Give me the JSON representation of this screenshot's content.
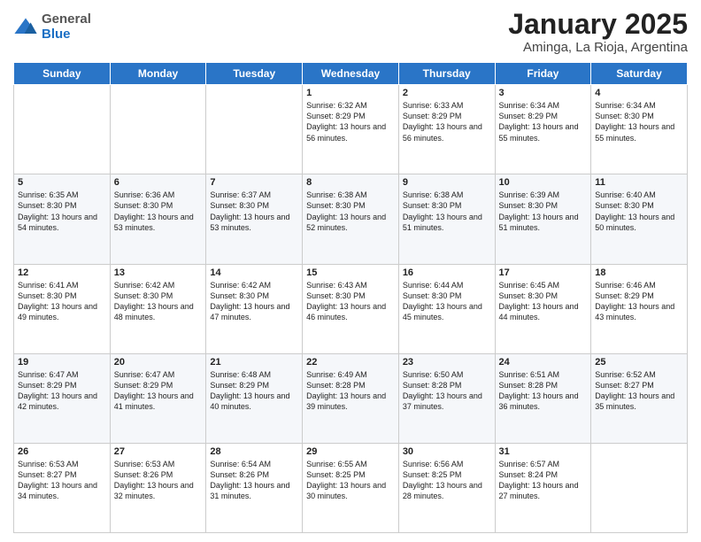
{
  "header": {
    "logo": {
      "general": "General",
      "blue": "Blue"
    },
    "title": "January 2025",
    "subtitle": "Aminga, La Rioja, Argentina"
  },
  "days_of_week": [
    "Sunday",
    "Monday",
    "Tuesday",
    "Wednesday",
    "Thursday",
    "Friday",
    "Saturday"
  ],
  "weeks": [
    [
      {
        "day": "",
        "info": ""
      },
      {
        "day": "",
        "info": ""
      },
      {
        "day": "",
        "info": ""
      },
      {
        "day": "1",
        "info": "Sunrise: 6:32 AM\nSunset: 8:29 PM\nDaylight: 13 hours and 56 minutes."
      },
      {
        "day": "2",
        "info": "Sunrise: 6:33 AM\nSunset: 8:29 PM\nDaylight: 13 hours and 56 minutes."
      },
      {
        "day": "3",
        "info": "Sunrise: 6:34 AM\nSunset: 8:29 PM\nDaylight: 13 hours and 55 minutes."
      },
      {
        "day": "4",
        "info": "Sunrise: 6:34 AM\nSunset: 8:30 PM\nDaylight: 13 hours and 55 minutes."
      }
    ],
    [
      {
        "day": "5",
        "info": "Sunrise: 6:35 AM\nSunset: 8:30 PM\nDaylight: 13 hours and 54 minutes."
      },
      {
        "day": "6",
        "info": "Sunrise: 6:36 AM\nSunset: 8:30 PM\nDaylight: 13 hours and 53 minutes."
      },
      {
        "day": "7",
        "info": "Sunrise: 6:37 AM\nSunset: 8:30 PM\nDaylight: 13 hours and 53 minutes."
      },
      {
        "day": "8",
        "info": "Sunrise: 6:38 AM\nSunset: 8:30 PM\nDaylight: 13 hours and 52 minutes."
      },
      {
        "day": "9",
        "info": "Sunrise: 6:38 AM\nSunset: 8:30 PM\nDaylight: 13 hours and 51 minutes."
      },
      {
        "day": "10",
        "info": "Sunrise: 6:39 AM\nSunset: 8:30 PM\nDaylight: 13 hours and 51 minutes."
      },
      {
        "day": "11",
        "info": "Sunrise: 6:40 AM\nSunset: 8:30 PM\nDaylight: 13 hours and 50 minutes."
      }
    ],
    [
      {
        "day": "12",
        "info": "Sunrise: 6:41 AM\nSunset: 8:30 PM\nDaylight: 13 hours and 49 minutes."
      },
      {
        "day": "13",
        "info": "Sunrise: 6:42 AM\nSunset: 8:30 PM\nDaylight: 13 hours and 48 minutes."
      },
      {
        "day": "14",
        "info": "Sunrise: 6:42 AM\nSunset: 8:30 PM\nDaylight: 13 hours and 47 minutes."
      },
      {
        "day": "15",
        "info": "Sunrise: 6:43 AM\nSunset: 8:30 PM\nDaylight: 13 hours and 46 minutes."
      },
      {
        "day": "16",
        "info": "Sunrise: 6:44 AM\nSunset: 8:30 PM\nDaylight: 13 hours and 45 minutes."
      },
      {
        "day": "17",
        "info": "Sunrise: 6:45 AM\nSunset: 8:30 PM\nDaylight: 13 hours and 44 minutes."
      },
      {
        "day": "18",
        "info": "Sunrise: 6:46 AM\nSunset: 8:29 PM\nDaylight: 13 hours and 43 minutes."
      }
    ],
    [
      {
        "day": "19",
        "info": "Sunrise: 6:47 AM\nSunset: 8:29 PM\nDaylight: 13 hours and 42 minutes."
      },
      {
        "day": "20",
        "info": "Sunrise: 6:47 AM\nSunset: 8:29 PM\nDaylight: 13 hours and 41 minutes."
      },
      {
        "day": "21",
        "info": "Sunrise: 6:48 AM\nSunset: 8:29 PM\nDaylight: 13 hours and 40 minutes."
      },
      {
        "day": "22",
        "info": "Sunrise: 6:49 AM\nSunset: 8:28 PM\nDaylight: 13 hours and 39 minutes."
      },
      {
        "day": "23",
        "info": "Sunrise: 6:50 AM\nSunset: 8:28 PM\nDaylight: 13 hours and 37 minutes."
      },
      {
        "day": "24",
        "info": "Sunrise: 6:51 AM\nSunset: 8:28 PM\nDaylight: 13 hours and 36 minutes."
      },
      {
        "day": "25",
        "info": "Sunrise: 6:52 AM\nSunset: 8:27 PM\nDaylight: 13 hours and 35 minutes."
      }
    ],
    [
      {
        "day": "26",
        "info": "Sunrise: 6:53 AM\nSunset: 8:27 PM\nDaylight: 13 hours and 34 minutes."
      },
      {
        "day": "27",
        "info": "Sunrise: 6:53 AM\nSunset: 8:26 PM\nDaylight: 13 hours and 32 minutes."
      },
      {
        "day": "28",
        "info": "Sunrise: 6:54 AM\nSunset: 8:26 PM\nDaylight: 13 hours and 31 minutes."
      },
      {
        "day": "29",
        "info": "Sunrise: 6:55 AM\nSunset: 8:25 PM\nDaylight: 13 hours and 30 minutes."
      },
      {
        "day": "30",
        "info": "Sunrise: 6:56 AM\nSunset: 8:25 PM\nDaylight: 13 hours and 28 minutes."
      },
      {
        "day": "31",
        "info": "Sunrise: 6:57 AM\nSunset: 8:24 PM\nDaylight: 13 hours and 27 minutes."
      },
      {
        "day": "",
        "info": ""
      }
    ]
  ]
}
